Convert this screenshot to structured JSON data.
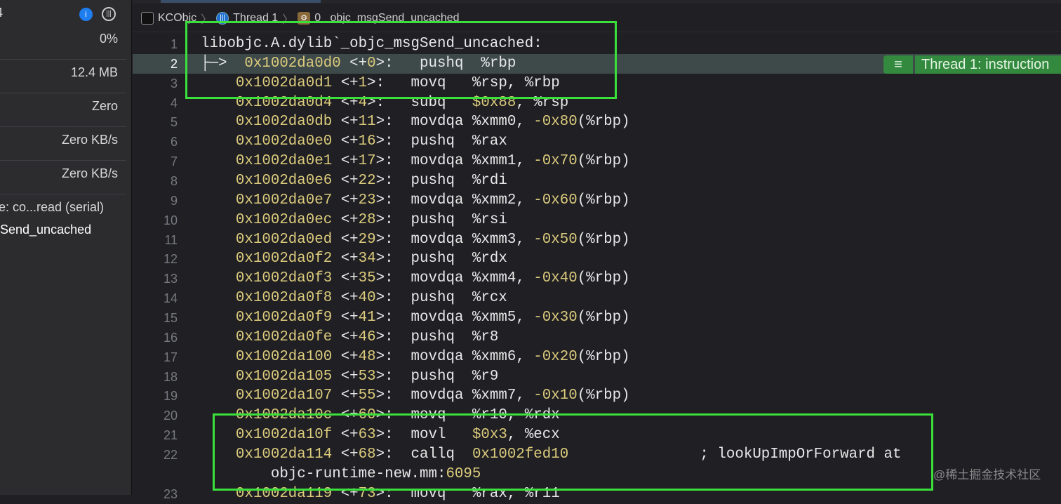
{
  "sidebar": {
    "rows": [
      "4",
      "0%",
      "12.4 MB",
      "Zero",
      "Zero KB/s",
      "Zero KB/s",
      "e: co...read (serial)",
      "Send_uncached"
    ]
  },
  "breadcrumb": {
    "project": "KCObjc",
    "thread": "Thread 1",
    "frame": "0 _objc_msgSend_uncached"
  },
  "badge": {
    "label": "Thread 1: instruction"
  },
  "watermark": "@稀土掘金技术社区",
  "colors": {
    "highlight_box": "#3be03b",
    "badge": "#338a3e",
    "number": "#dccb7c"
  },
  "lines": [
    {
      "n": "1",
      "segs": [
        [
          "libobjc.A.dylib`_objc_msgSend_uncached:",
          ""
        ]
      ]
    },
    {
      "n": "2",
      "segs": [
        [
          "├─>  ",
          ""
        ],
        [
          "0x1002da0d0",
          "y"
        ],
        [
          " <+",
          ""
        ],
        [
          "0",
          "y"
        ],
        [
          ">:   pushq  %rbp",
          ""
        ]
      ]
    },
    {
      "n": "3",
      "segs": [
        [
          "    ",
          ""
        ],
        [
          "0x1002da0d1",
          "y"
        ],
        [
          " <+",
          ""
        ],
        [
          "1",
          "y"
        ],
        [
          ">:   movq   %rsp, %rbp",
          ""
        ]
      ]
    },
    {
      "n": "4",
      "segs": [
        [
          "    ",
          ""
        ],
        [
          "0x1002da0d4",
          "y"
        ],
        [
          " <+",
          ""
        ],
        [
          "4",
          "y"
        ],
        [
          ">:   subq   ",
          ""
        ],
        [
          "$0x88",
          "y"
        ],
        [
          ", %rsp",
          ""
        ]
      ]
    },
    {
      "n": "5",
      "segs": [
        [
          "    ",
          ""
        ],
        [
          "0x1002da0db",
          "y"
        ],
        [
          " <+",
          ""
        ],
        [
          "11",
          "y"
        ],
        [
          ">:  movdqa %xmm0, ",
          ""
        ],
        [
          "-0x80",
          "y"
        ],
        [
          "(%rbp)",
          ""
        ]
      ]
    },
    {
      "n": "6",
      "segs": [
        [
          "    ",
          ""
        ],
        [
          "0x1002da0e0",
          "y"
        ],
        [
          " <+",
          ""
        ],
        [
          "16",
          "y"
        ],
        [
          ">:  pushq  %rax",
          ""
        ]
      ]
    },
    {
      "n": "7",
      "segs": [
        [
          "    ",
          ""
        ],
        [
          "0x1002da0e1",
          "y"
        ],
        [
          " <+",
          ""
        ],
        [
          "17",
          "y"
        ],
        [
          ">:  movdqa %xmm1, ",
          ""
        ],
        [
          "-0x70",
          "y"
        ],
        [
          "(%rbp)",
          ""
        ]
      ]
    },
    {
      "n": "8",
      "segs": [
        [
          "    ",
          ""
        ],
        [
          "0x1002da0e6",
          "y"
        ],
        [
          " <+",
          ""
        ],
        [
          "22",
          "y"
        ],
        [
          ">:  pushq  %rdi",
          ""
        ]
      ]
    },
    {
      "n": "9",
      "segs": [
        [
          "    ",
          ""
        ],
        [
          "0x1002da0e7",
          "y"
        ],
        [
          " <+",
          ""
        ],
        [
          "23",
          "y"
        ],
        [
          ">:  movdqa %xmm2, ",
          ""
        ],
        [
          "-0x60",
          "y"
        ],
        [
          "(%rbp)",
          ""
        ]
      ]
    },
    {
      "n": "10",
      "segs": [
        [
          "    ",
          ""
        ],
        [
          "0x1002da0ec",
          "y"
        ],
        [
          " <+",
          ""
        ],
        [
          "28",
          "y"
        ],
        [
          ">:  pushq  %rsi",
          ""
        ]
      ]
    },
    {
      "n": "11",
      "segs": [
        [
          "    ",
          ""
        ],
        [
          "0x1002da0ed",
          "y"
        ],
        [
          " <+",
          ""
        ],
        [
          "29",
          "y"
        ],
        [
          ">:  movdqa %xmm3, ",
          ""
        ],
        [
          "-0x50",
          "y"
        ],
        [
          "(%rbp)",
          ""
        ]
      ]
    },
    {
      "n": "12",
      "segs": [
        [
          "    ",
          ""
        ],
        [
          "0x1002da0f2",
          "y"
        ],
        [
          " <+",
          ""
        ],
        [
          "34",
          "y"
        ],
        [
          ">:  pushq  %rdx",
          ""
        ]
      ]
    },
    {
      "n": "13",
      "segs": [
        [
          "    ",
          ""
        ],
        [
          "0x1002da0f3",
          "y"
        ],
        [
          " <+",
          ""
        ],
        [
          "35",
          "y"
        ],
        [
          ">:  movdqa %xmm4, ",
          ""
        ],
        [
          "-0x40",
          "y"
        ],
        [
          "(%rbp)",
          ""
        ]
      ]
    },
    {
      "n": "14",
      "segs": [
        [
          "    ",
          ""
        ],
        [
          "0x1002da0f8",
          "y"
        ],
        [
          " <+",
          ""
        ],
        [
          "40",
          "y"
        ],
        [
          ">:  pushq  %rcx",
          ""
        ]
      ]
    },
    {
      "n": "15",
      "segs": [
        [
          "    ",
          ""
        ],
        [
          "0x1002da0f9",
          "y"
        ],
        [
          " <+",
          ""
        ],
        [
          "41",
          "y"
        ],
        [
          ">:  movdqa %xmm5, ",
          ""
        ],
        [
          "-0x30",
          "y"
        ],
        [
          "(%rbp)",
          ""
        ]
      ]
    },
    {
      "n": "16",
      "segs": [
        [
          "    ",
          ""
        ],
        [
          "0x1002da0fe",
          "y"
        ],
        [
          " <+",
          ""
        ],
        [
          "46",
          "y"
        ],
        [
          ">:  pushq  %r8",
          ""
        ]
      ]
    },
    {
      "n": "17",
      "segs": [
        [
          "    ",
          ""
        ],
        [
          "0x1002da100",
          "y"
        ],
        [
          " <+",
          ""
        ],
        [
          "48",
          "y"
        ],
        [
          ">:  movdqa %xmm6, ",
          ""
        ],
        [
          "-0x20",
          "y"
        ],
        [
          "(%rbp)",
          ""
        ]
      ]
    },
    {
      "n": "18",
      "segs": [
        [
          "    ",
          ""
        ],
        [
          "0x1002da105",
          "y"
        ],
        [
          " <+",
          ""
        ],
        [
          "53",
          "y"
        ],
        [
          ">:  pushq  %r9",
          ""
        ]
      ]
    },
    {
      "n": "19",
      "segs": [
        [
          "    ",
          ""
        ],
        [
          "0x1002da107",
          "y"
        ],
        [
          " <+",
          ""
        ],
        [
          "55",
          "y"
        ],
        [
          ">:  movdqa %xmm7, ",
          ""
        ],
        [
          "-0x10",
          "y"
        ],
        [
          "(%rbp)",
          ""
        ]
      ]
    },
    {
      "n": "20",
      "segs": [
        [
          "    ",
          ""
        ],
        [
          "0x1002da10c",
          "y"
        ],
        [
          " <+",
          ""
        ],
        [
          "60",
          "y"
        ],
        [
          ">:  movq   %r10, %rdx",
          ""
        ]
      ]
    },
    {
      "n": "21",
      "segs": [
        [
          "    ",
          ""
        ],
        [
          "0x1002da10f",
          "y"
        ],
        [
          " <+",
          ""
        ],
        [
          "63",
          "y"
        ],
        [
          ">:  movl   ",
          ""
        ],
        [
          "$0x3",
          "y"
        ],
        [
          ", %ecx",
          ""
        ]
      ]
    },
    {
      "n": "22",
      "segs": [
        [
          "    ",
          ""
        ],
        [
          "0x1002da114",
          "y"
        ],
        [
          " <+",
          ""
        ],
        [
          "68",
          "y"
        ],
        [
          ">:  callq  ",
          ""
        ],
        [
          "0x1002fed10",
          "y"
        ],
        [
          "               ; lookUpImpOrForward at",
          ""
        ]
      ]
    },
    {
      "n": "",
      "segs": [
        [
          "        objc-runtime-new.mm:",
          ""
        ],
        [
          "6095",
          "y"
        ]
      ]
    },
    {
      "n": "23",
      "segs": [
        [
          "    ",
          ""
        ],
        [
          "0x1002da119",
          "y"
        ],
        [
          " <+",
          ""
        ],
        [
          "73",
          "y"
        ],
        [
          ">:  movq   %rax, %r11",
          ""
        ]
      ]
    }
  ]
}
